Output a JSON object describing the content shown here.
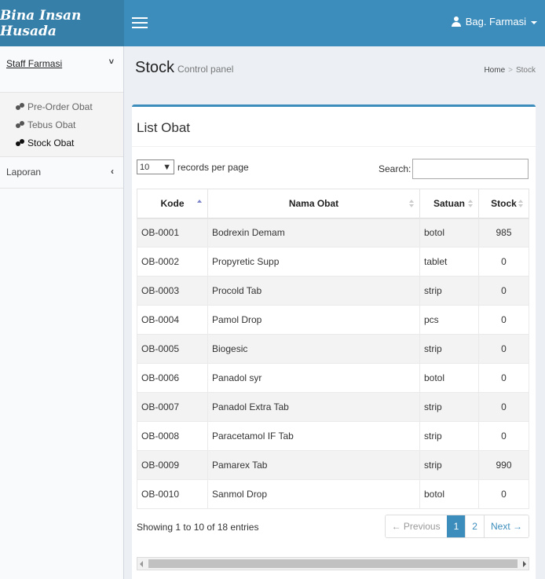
{
  "app": {
    "logo": "Bina Insan Husada"
  },
  "header": {
    "user_name": "Bag. Farmasi"
  },
  "sidebar": {
    "group_title": "Staff Farmasi",
    "group_chevron": "˅",
    "items": [
      {
        "label": "Pre-Order Obat",
        "icon": "pills-icon"
      },
      {
        "label": "Tebus Obat",
        "icon": "pills-icon"
      },
      {
        "label": "Stock Obat",
        "icon": "pills-icon"
      }
    ],
    "laporan": "Laporan",
    "laporan_chevron": "‹"
  },
  "page": {
    "title": "Stock",
    "subtitle": "Control panel",
    "breadcrumb": {
      "home": "Home",
      "sep": ">",
      "current": "Stock"
    }
  },
  "box": {
    "title": "List Obat",
    "length_value": "10",
    "length_label": "records per page",
    "search_label": "Search:",
    "search_value": "",
    "columns": [
      "Kode",
      "Nama Obat",
      "Satuan",
      "Stock"
    ],
    "rows": [
      {
        "kode": "OB-0001",
        "nama": "Bodrexin Demam",
        "satuan": "botol",
        "stock": "985"
      },
      {
        "kode": "OB-0002",
        "nama": "Propyretic Supp",
        "satuan": "tablet",
        "stock": "0"
      },
      {
        "kode": "OB-0003",
        "nama": "Procold Tab",
        "satuan": "strip",
        "stock": "0"
      },
      {
        "kode": "OB-0004",
        "nama": "Pamol Drop",
        "satuan": "pcs",
        "stock": "0"
      },
      {
        "kode": "OB-0005",
        "nama": "Biogesic",
        "satuan": "strip",
        "stock": "0"
      },
      {
        "kode": "OB-0006",
        "nama": "Panadol syr",
        "satuan": "botol",
        "stock": "0"
      },
      {
        "kode": "OB-0007",
        "nama": "Panadol Extra Tab",
        "satuan": "strip",
        "stock": "0"
      },
      {
        "kode": "OB-0008",
        "nama": "Paracetamol IF Tab",
        "satuan": "strip",
        "stock": "0"
      },
      {
        "kode": "OB-0009",
        "nama": "Pamarex Tab",
        "satuan": "strip",
        "stock": "990"
      },
      {
        "kode": "OB-0010",
        "nama": "Sanmol Drop",
        "satuan": "botol",
        "stock": "0"
      }
    ],
    "info": "Showing 1 to 10 of 18 entries",
    "pager": {
      "prev": "← Previous",
      "page1": "1",
      "page2": "2",
      "next": "Next →"
    }
  },
  "colors": {
    "header": "#3c8dbc",
    "logo_bg": "#367fa9",
    "accent": "#3c8dbc"
  }
}
